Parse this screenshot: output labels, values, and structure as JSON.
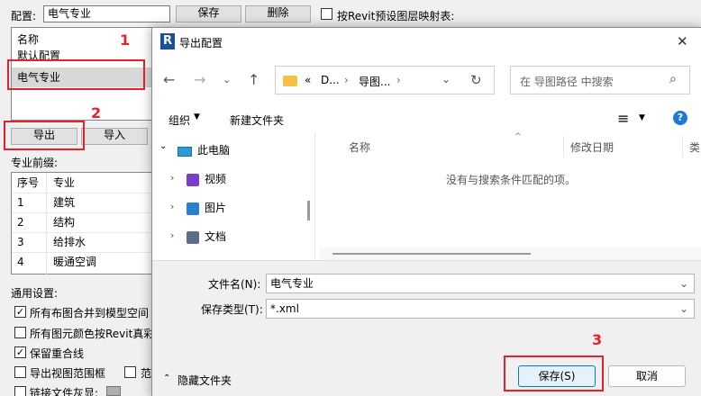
{
  "bg": {
    "config_label": "配置:",
    "config_value": "电气专业",
    "save_btn": "保存",
    "delete_btn": "删除",
    "map_checkbox_label": "按Revit预设图层映射表:",
    "list_header": "名称",
    "list_items": [
      "默认配置",
      "电气专业"
    ],
    "export_btn": "导出",
    "import_btn": "导入",
    "prefix_label": "专业前缀:",
    "table_headers": [
      "序号",
      "专业"
    ],
    "table_rows": [
      {
        "no": "1",
        "name": "建筑"
      },
      {
        "no": "2",
        "name": "结构"
      },
      {
        "no": "3",
        "name": "给排水"
      },
      {
        "no": "4",
        "name": "暖通空调"
      }
    ],
    "general_label": "通用设置:",
    "options": [
      {
        "label": "所有布图合并到模型空间",
        "checked": true
      },
      {
        "label": "所有图元颜色按Revit真彩",
        "checked": false
      },
      {
        "label": "保留重合线",
        "checked": true
      },
      {
        "label": "导出视图范围框",
        "checked": false
      },
      {
        "label": "链接文件灰显:",
        "checked": false
      }
    ],
    "extra_option_label": "范",
    "annotations": [
      "1",
      "2",
      "3"
    ]
  },
  "dialog": {
    "title": "导出配置",
    "close_glyph": "✕",
    "breadcrumb": [
      "«",
      "D...",
      "›",
      "导图...",
      "›"
    ],
    "search_placeholder": "在 导图路径 中搜索",
    "organize": "组织",
    "new_folder": "新建文件夹",
    "help": "?",
    "tree": [
      {
        "label": "此电脑",
        "icon": "computer-icon",
        "expanded": true
      },
      {
        "label": "视频",
        "icon": "video-folder-icon"
      },
      {
        "label": "图片",
        "icon": "picture-folder-icon"
      },
      {
        "label": "文档",
        "icon": "document-folder-icon"
      }
    ],
    "columns": [
      "名称",
      "修改日期",
      "类"
    ],
    "empty_message": "没有与搜索条件匹配的项。",
    "filename_label": "文件名(N):",
    "filename_value": "电气专业",
    "filetype_label": "保存类型(T):",
    "filetype_value": "*.xml",
    "hide_folders": "隐藏文件夹",
    "save_btn": "保存(S)",
    "cancel_btn": "取消"
  },
  "colors": {
    "annotation": "#e8202a",
    "revit_logo": "#1a4f9c",
    "primary_border": "#0078d4"
  }
}
